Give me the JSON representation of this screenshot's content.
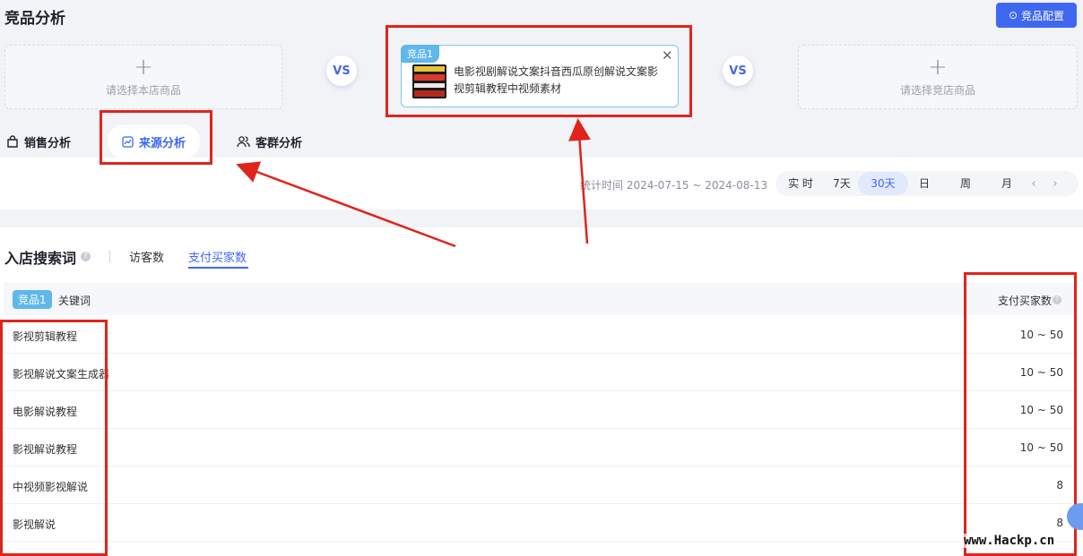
{
  "header": {
    "title": "竞品分析",
    "config_button": "竞品配置"
  },
  "compare": {
    "own_slot_hint": "请选择本店商品",
    "vs_label": "VS",
    "competitor_slot_hint": "请选择竞店商品",
    "product": {
      "badge": "竞品1",
      "title": "电影视剧解说文案抖音西瓜原创解说文案影视剪辑教程中视频素材"
    }
  },
  "tabs": [
    {
      "label": "销售分析",
      "icon": "bag-icon"
    },
    {
      "label": "来源分析",
      "icon": "trend-chart-icon"
    },
    {
      "label": "客群分析",
      "icon": "users-icon"
    }
  ],
  "time_bar": {
    "stat_time": "统计时间 2024-07-15 ~ 2024-08-13",
    "options": [
      "实 时",
      "7天",
      "30天",
      "日",
      "周",
      "月"
    ],
    "selected": "30天"
  },
  "section": {
    "title": "入店搜索词",
    "sub_tabs": [
      "访客数",
      "支付买家数"
    ],
    "selected_sub_tab": "支付买家数"
  },
  "table": {
    "badge": "竞品1",
    "keyword_header": "关键词",
    "buyers_header": "支付买家数",
    "rows": [
      {
        "keyword": "影视剪辑教程",
        "buyers": "10 ~ 50"
      },
      {
        "keyword": "影视解说文案生成器",
        "buyers": "10 ~ 50"
      },
      {
        "keyword": "电影解说教程",
        "buyers": "10 ~ 50"
      },
      {
        "keyword": "影视解说教程",
        "buyers": "10 ~ 50"
      },
      {
        "keyword": "中视频影视解说",
        "buyers": "8"
      },
      {
        "keyword": "影视解说",
        "buyers": "8"
      }
    ]
  },
  "watermark": "www.Hackp.cn",
  "colors": {
    "accent": "#3f68f0",
    "badge": "#5fb7ec",
    "annotation": "#e0241c"
  }
}
